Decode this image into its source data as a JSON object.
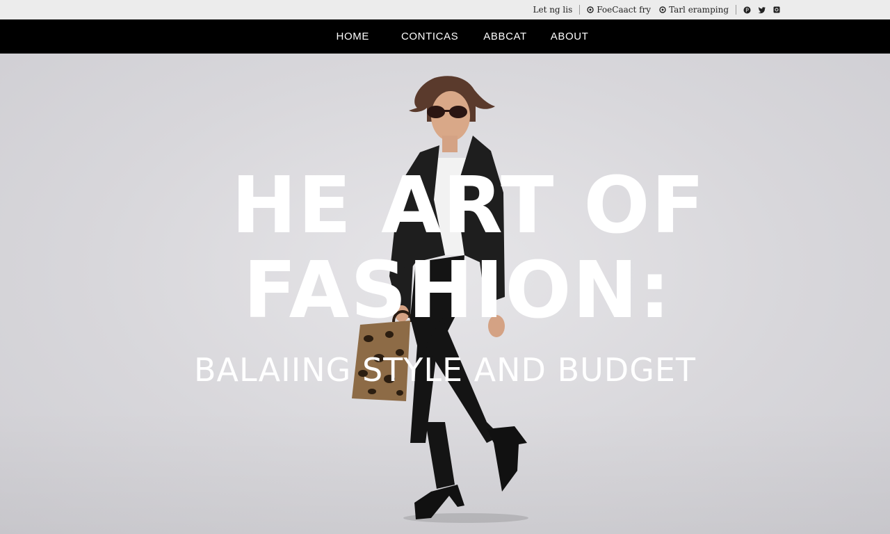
{
  "utility_bar": {
    "items": [
      {
        "label": "Let ng lis",
        "icon": ""
      },
      {
        "label": "FoeCaact fry",
        "icon": "circle-icon"
      },
      {
        "label": "Tarl eramping",
        "icon": "circle-icon"
      }
    ],
    "social_icons": [
      "pinterest-icon",
      "twitter-icon",
      "instagram-icon"
    ]
  },
  "nav": {
    "links": [
      "HOME",
      "CONTICAS",
      "ABBCAT",
      "ABOUT"
    ]
  },
  "hero": {
    "headline_line1": "HE ART OF",
    "headline_line2": "FASHION:",
    "subheadline": "BALAIING STYLE AND BUDGET"
  },
  "colors": {
    "nav_bg": "#000000",
    "utility_bg": "#ececec",
    "hero_bg": "#dcdbde",
    "headline": "#ffffff"
  }
}
